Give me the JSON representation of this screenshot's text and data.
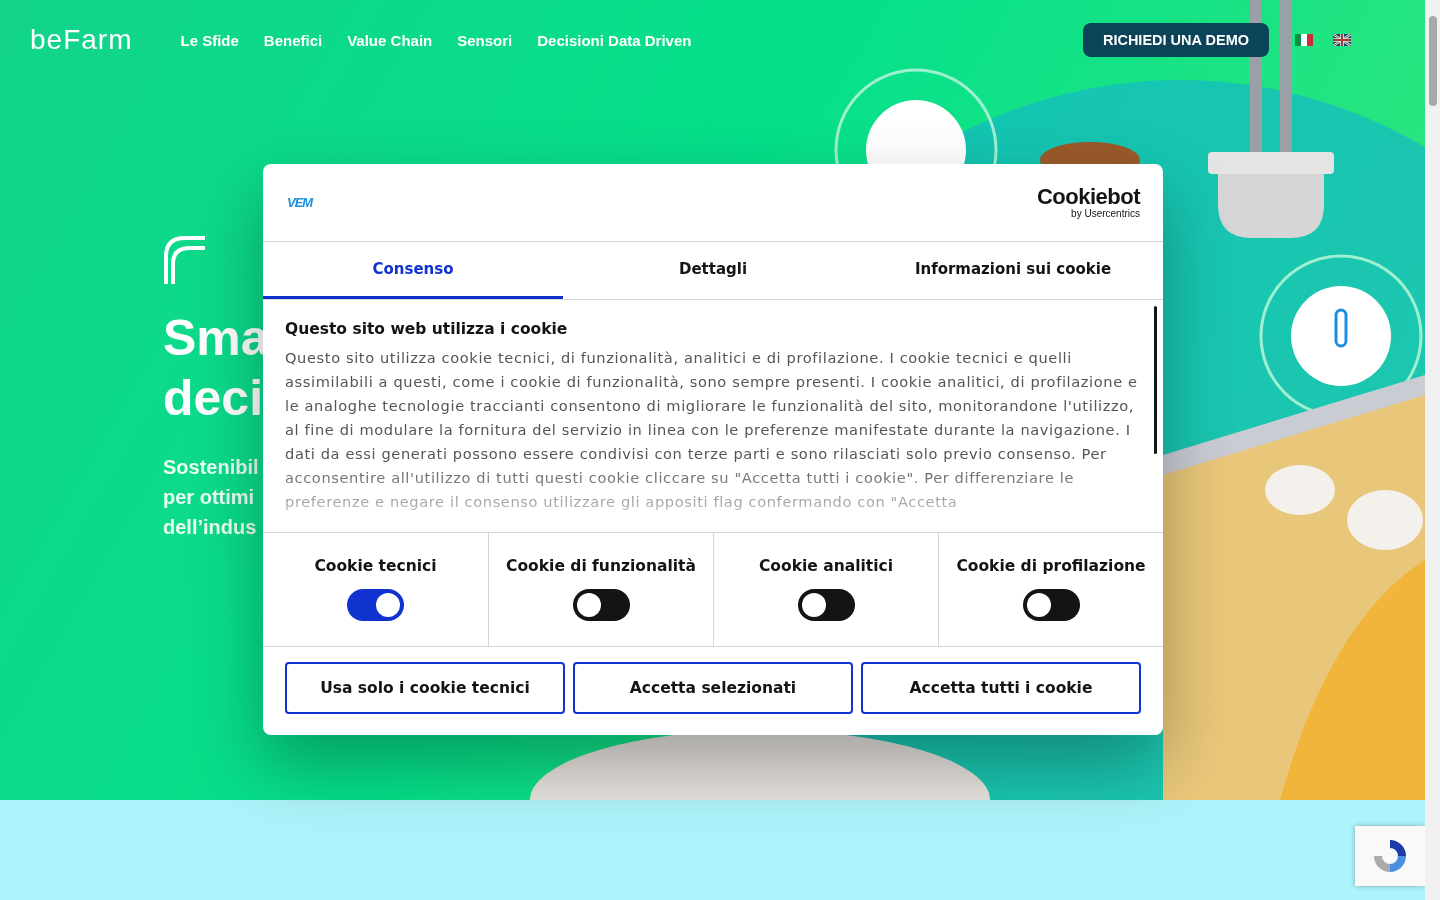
{
  "header": {
    "logo": "beFarm",
    "nav": [
      {
        "label": "Le Sfide"
      },
      {
        "label": "Benefici"
      },
      {
        "label": "Value Chain"
      },
      {
        "label": "Sensori"
      },
      {
        "label": "Decisioni Data Driven"
      }
    ],
    "cta": "RICHIEDI UNA DEMO",
    "languages": [
      {
        "kind": "it",
        "selected": true
      },
      {
        "kind": "en",
        "selected": false
      }
    ]
  },
  "hero": {
    "title_lines": [
      "Sma",
      "deci"
    ],
    "subtitle_lines": [
      "Sostenibil",
      "per ottimi",
      "dell’indus"
    ]
  },
  "cookie_dialog": {
    "brand": "VEM",
    "provider": {
      "name": "Cookiebot",
      "byline": "by Usercentrics"
    },
    "tabs": [
      {
        "label": "Consenso",
        "selected": true
      },
      {
        "label": "Dettagli",
        "selected": false
      },
      {
        "label": "Informazioni sui cookie",
        "selected": false
      }
    ],
    "heading": "Questo sito web utilizza i cookie",
    "body": "Questo sito utilizza cookie tecnici, di funzionalità, analitici e di profilazione. I cookie tecnici e quelli assimilabili a questi, come i cookie di funzionalità, sono sempre presenti. I cookie analitici, di profilazione e le analoghe tecnologie traccianti consentono di migliorare le funzionalità del sito, monitorandone l'utilizzo, al fine di modulare la fornitura del servizio in linea con le preferenze manifestate durante la navigazione. I dati da essi generati possono essere condivisi con terze parti e sono rilasciati solo previo consenso. Per acconsentire all'utilizzo di tutti questi cookie cliccare su \"Accetta tutti i cookie\". Per differenziare le preferenze e negare il consenso utilizzare gli appositi flag confermando con \"Accetta",
    "toggles": [
      {
        "label": "Cookie tecnici",
        "on": true
      },
      {
        "label": "Cookie di funzionalità",
        "on": false
      },
      {
        "label": "Cookie analitici",
        "on": false
      },
      {
        "label": "Cookie di profilazione",
        "on": false
      }
    ],
    "buttons": [
      "Usa solo i cookie tecnici",
      "Accetta selezionati",
      "Accetta tutti i cookie"
    ]
  }
}
